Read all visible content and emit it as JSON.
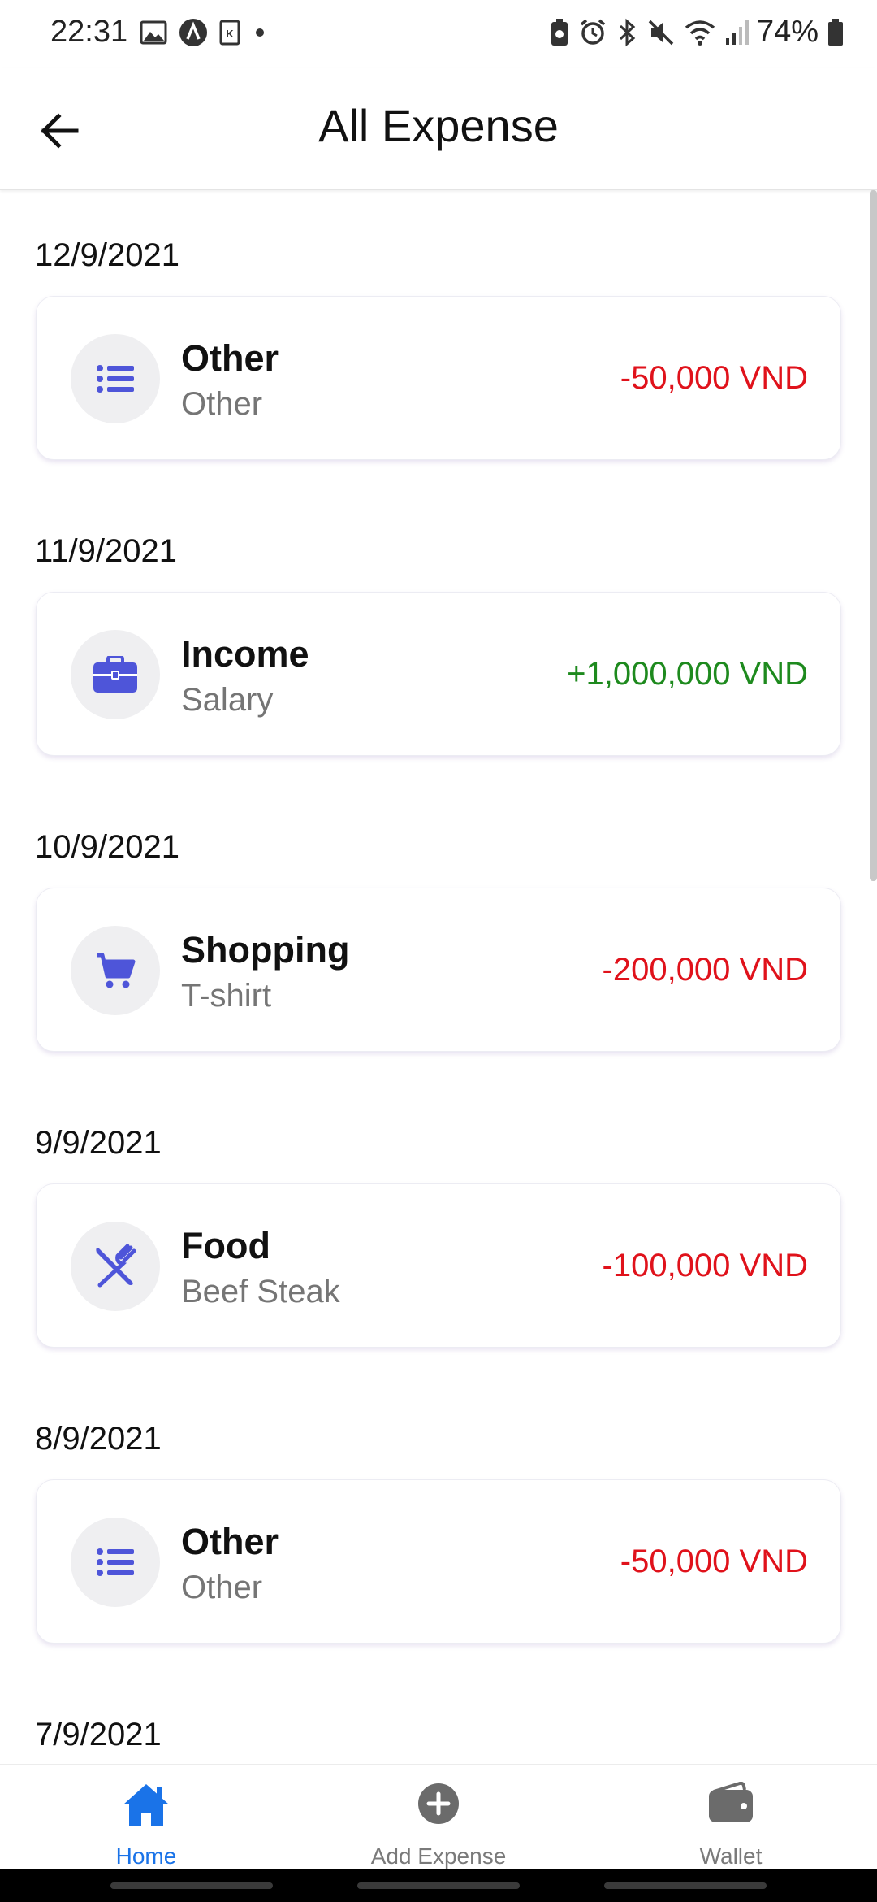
{
  "status_bar": {
    "time": "22:31",
    "battery_percent": "74%",
    "left_icons": [
      "image-icon",
      "app-a-icon",
      "app-k-icon",
      "dot-icon"
    ],
    "right_icons": [
      "battery-saver-icon",
      "alarm-icon",
      "bluetooth-icon",
      "mute-icon",
      "wifi-icon",
      "signal-icon",
      "battery-icon"
    ]
  },
  "header": {
    "title": "All Expense"
  },
  "expenses": [
    {
      "date": "12/9/2021",
      "category": "Other",
      "note": "Other",
      "amount": "-50,000 VND",
      "type": "expense",
      "icon": "list-icon"
    },
    {
      "date": "11/9/2021",
      "category": "Income",
      "note": "Salary",
      "amount": "+1,000,000 VND",
      "type": "income",
      "icon": "briefcase-icon"
    },
    {
      "date": "10/9/2021",
      "category": "Shopping",
      "note": "T-shirt",
      "amount": "-200,000 VND",
      "type": "expense",
      "icon": "cart-icon"
    },
    {
      "date": "9/9/2021",
      "category": "Food",
      "note": "Beef Steak",
      "amount": "-100,000 VND",
      "type": "expense",
      "icon": "utensils-icon"
    },
    {
      "date": "8/9/2021",
      "category": "Other",
      "note": "Other",
      "amount": "-50,000 VND",
      "type": "expense",
      "icon": "list-icon"
    },
    {
      "date": "7/9/2021"
    }
  ],
  "bottom_nav": {
    "items": [
      {
        "label": "Home",
        "icon": "home-icon",
        "active": true
      },
      {
        "label": "Add Expense",
        "icon": "add-circle-icon",
        "active": false
      },
      {
        "label": "Wallet",
        "icon": "wallet-icon",
        "active": false
      }
    ]
  },
  "colors": {
    "accent_icon": "#4E55D9",
    "expense": "#E0121B",
    "income": "#1E8A1E",
    "nav_active": "#1A73E8",
    "nav_inactive": "#7A7A7A"
  }
}
